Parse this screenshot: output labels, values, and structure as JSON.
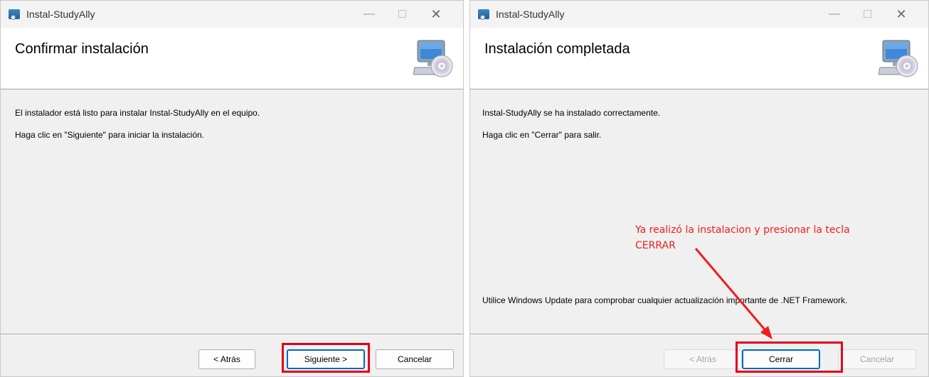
{
  "colors": {
    "highlight": "#e0001a",
    "annotation": "#f21c1c",
    "default_button_border": "#0067c0"
  },
  "left_window": {
    "title": "Instal-StudyAlly",
    "controls": {
      "minimize": "—",
      "close": "✕"
    },
    "heading": "Confirmar instalación",
    "banner_icon": "computer-cd-icon",
    "line1": "El instalador está listo para instalar Instal-StudyAlly en el equipo.",
    "line2": "Haga clic en \"Siguiente\" para iniciar la instalación.",
    "buttons": {
      "back": "< Atrás",
      "next": "Siguiente >",
      "cancel": "Cancelar"
    }
  },
  "right_window": {
    "title": "Instal-StudyAlly",
    "controls": {
      "minimize": "—",
      "close": "✕"
    },
    "heading": "Instalación completada",
    "banner_icon": "computer-cd-icon",
    "line1": "Instal-StudyAlly se ha instalado correctamente.",
    "line2": "Haga clic en \"Cerrar\" para salir.",
    "line3": "Utilice Windows Update para comprobar cualquier actualización importante de .NET Framework.",
    "buttons": {
      "back": "< Atrás",
      "close": "Cerrar",
      "cancel": "Cancelar"
    }
  },
  "annotation": {
    "line1": "Ya realizó la instalacion y presionar la tecla",
    "line2": "CERRAR"
  }
}
